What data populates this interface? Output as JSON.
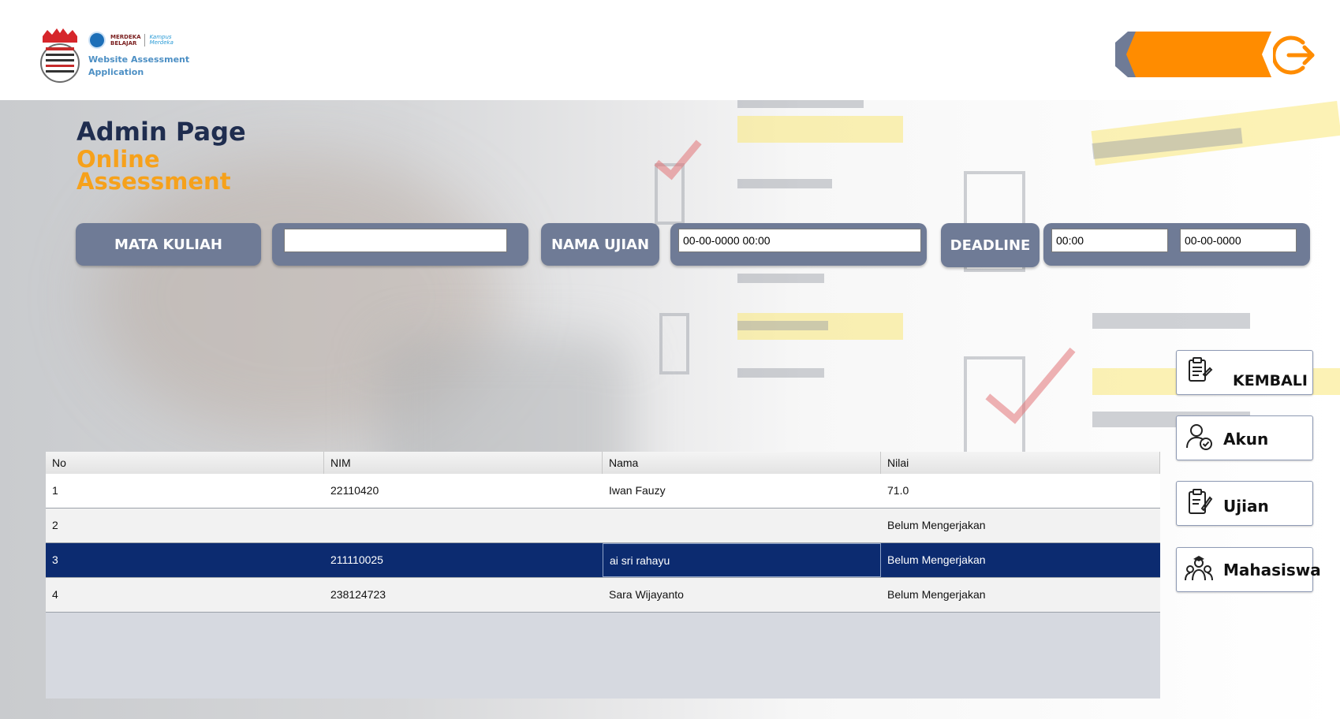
{
  "header": {
    "brand_badge_line1": "MERDEKA",
    "brand_badge_line2": "BELAJAR",
    "brand_kampus": "Kampus Merdeka",
    "brand_title_line1": "Website Assessment",
    "brand_title_line2": "Application"
  },
  "page": {
    "title": "Admin Page",
    "subtitle_line1": "Online",
    "subtitle_line2": "Assessment"
  },
  "filters": {
    "mata_kuliah_label": "MATA KULIAH",
    "mata_kuliah_value": "",
    "nama_ujian_label": "NAMA UJIAN",
    "nama_ujian_value": "00-00-0000 00:00",
    "deadline_label": "DEADLINE",
    "deadline_time": "00:00",
    "deadline_date": "00-00-0000"
  },
  "table": {
    "columns": [
      "No",
      "NIM",
      "Nama",
      "Nilai"
    ],
    "rows": [
      {
        "no": "1",
        "nim": "22110420",
        "nama": "Iwan Fauzy",
        "nilai": "71.0"
      },
      {
        "no": "2",
        "nim": "",
        "nama": "",
        "nilai": "Belum Mengerjakan"
      },
      {
        "no": "3",
        "nim": "211110025",
        "nama": "ai sri rahayu",
        "nilai": "Belum Mengerjakan"
      },
      {
        "no": "4",
        "nim": "238124723",
        "nama": "Sara Wijayanto",
        "nilai": "Belum Mengerjakan"
      }
    ],
    "selected_row": 3
  },
  "sidebar": {
    "kembali": "KEMBALI",
    "akun": "Akun",
    "ujian": "Ujian",
    "mahasiswa": "Mahasiswa"
  },
  "colors": {
    "accent_orange": "#f6a11b",
    "logout_orange": "#ff8c00",
    "label_slate": "#6f7b96",
    "selected_row": "#0c2b70",
    "title_navy": "#1f2d4f"
  },
  "icons": {
    "logout": "logout-icon",
    "kembali": "clipboard-list-icon",
    "akun": "user-check-icon",
    "ujian": "clipboard-pen-icon",
    "mahasiswa": "students-group-icon"
  }
}
